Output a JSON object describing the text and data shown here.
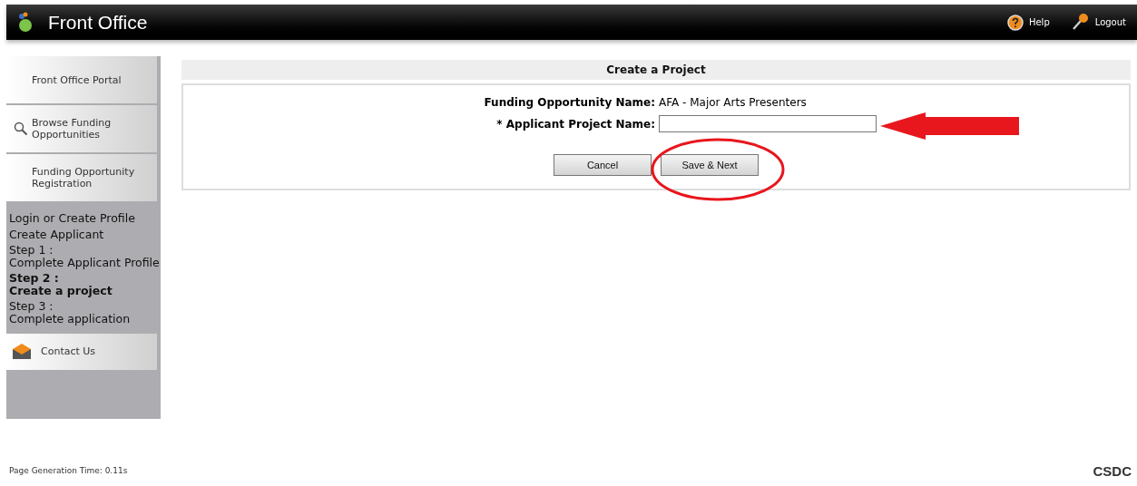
{
  "header": {
    "title": "Front Office",
    "links": [
      {
        "kind": "help",
        "label": "Help"
      },
      {
        "kind": "logout",
        "label": "Logout"
      }
    ]
  },
  "sidebar": {
    "items": [
      {
        "kind": "none",
        "label": "Front Office Portal"
      },
      {
        "kind": "search",
        "label": "Browse Funding Opportunities"
      },
      {
        "kind": "none",
        "label": "Funding Opportunity Registration"
      }
    ],
    "steps": [
      {
        "heading": "Login or Create Profile",
        "selected": false
      },
      {
        "heading": "Create Applicant",
        "selected": false
      },
      {
        "heading": "Step 1 :",
        "label": "Complete Applicant Profile",
        "selected": false
      },
      {
        "heading": "Step 2 :",
        "label": "Create a project",
        "selected": true
      },
      {
        "heading": "Step 3 :",
        "label": "Complete application",
        "selected": false
      }
    ],
    "contact": {
      "label": "Contact Us"
    }
  },
  "form": {
    "title": "Create a Project",
    "opportunity_label": "Funding Opportunity Name:",
    "opportunity_value": "AFA - Major Arts Presenters",
    "project_label": "* Applicant Project Name:",
    "buttons": [
      "Cancel",
      "Save & Next"
    ]
  },
  "footer": {
    "generation_time": "Page Generation Time: 0.11s",
    "logo": "CSDC"
  }
}
